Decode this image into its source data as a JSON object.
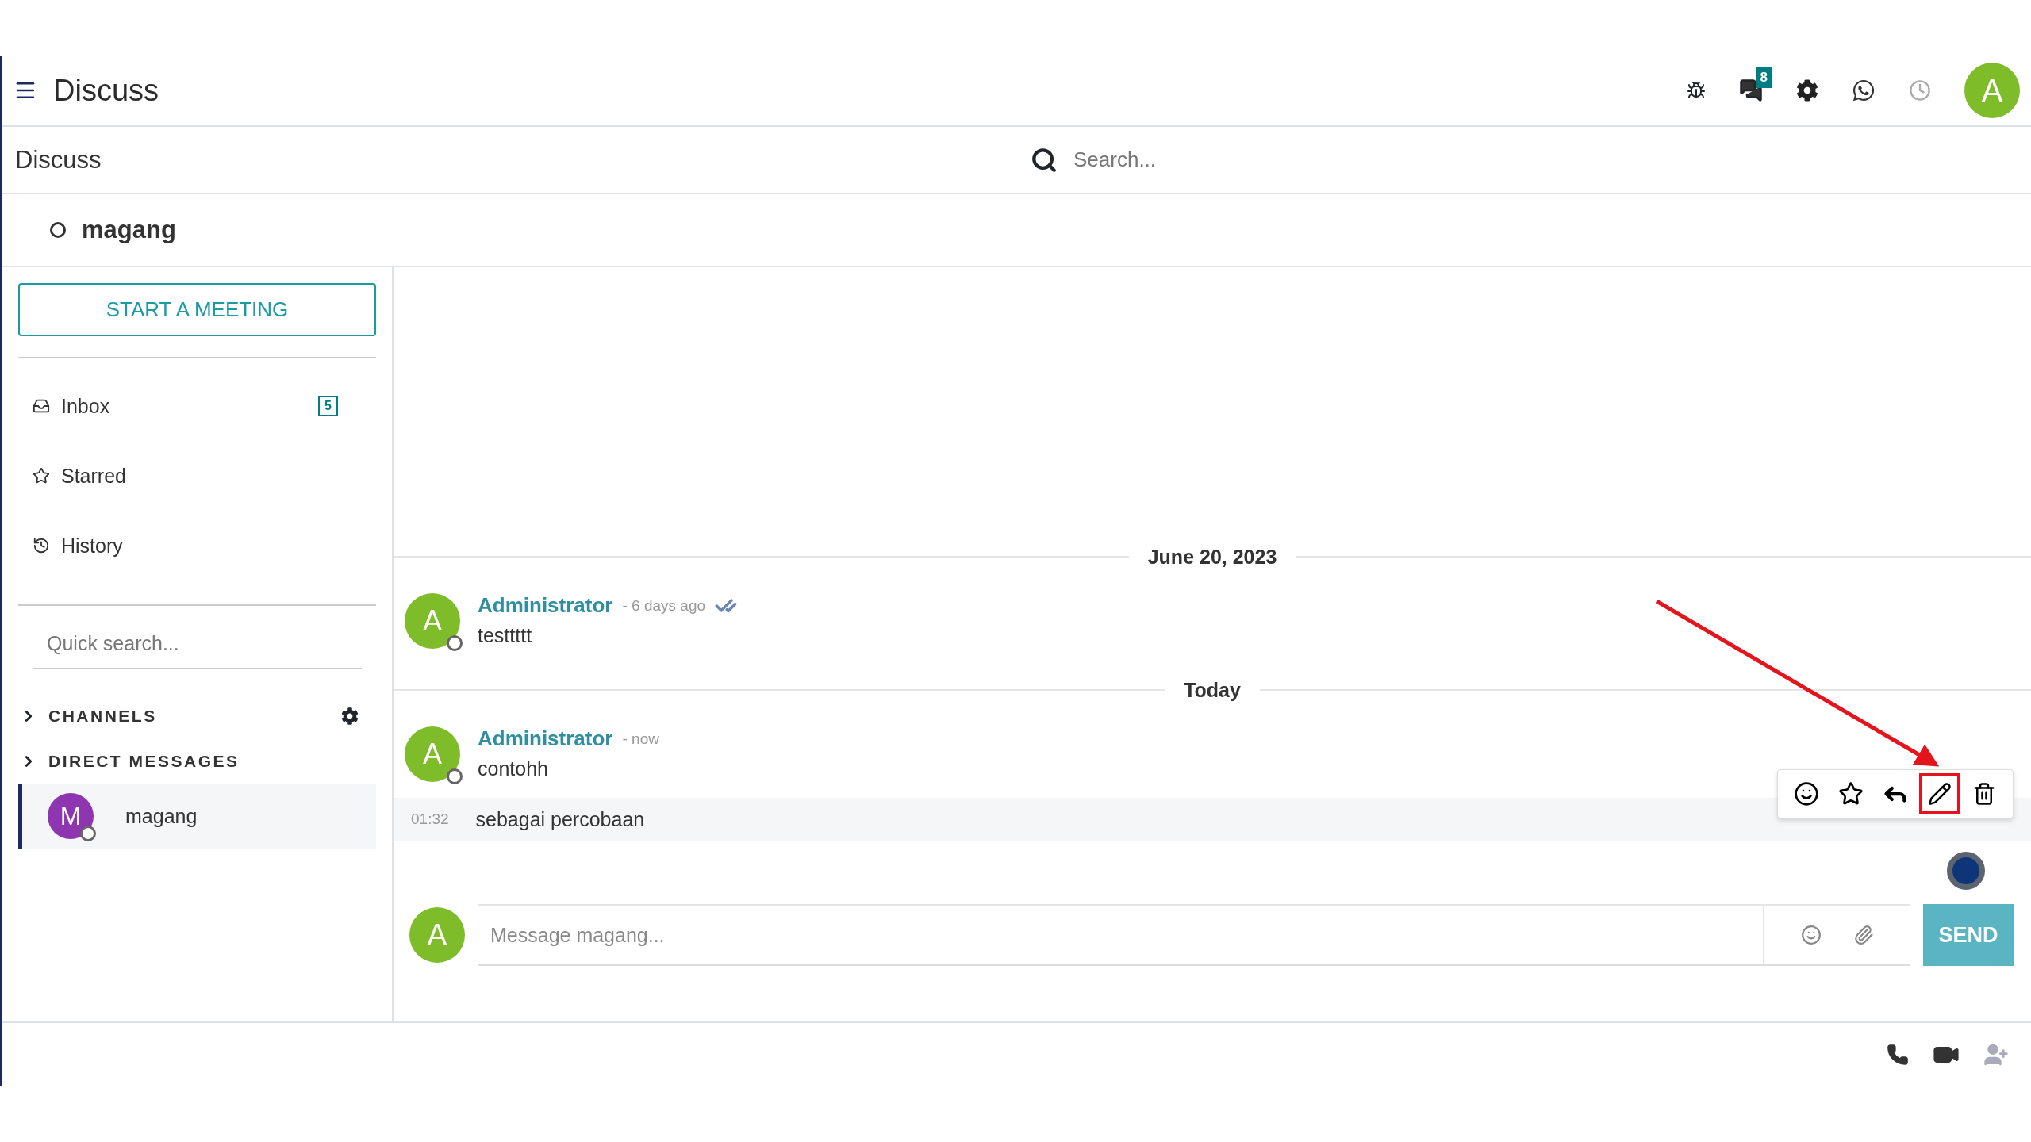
{
  "navbar": {
    "title": "Discuss",
    "chat_badge": "8",
    "avatar": "A"
  },
  "control_panel": {
    "breadcrumb": "Discuss",
    "search": {
      "placeholder": "Search..."
    }
  },
  "thread_header": {
    "name": "magang"
  },
  "sidebar": {
    "meeting_button": "START A MEETING",
    "mailboxes": [
      {
        "kind": "inbox",
        "label": "Inbox",
        "counter": "5"
      },
      {
        "kind": "starred",
        "label": "Starred"
      },
      {
        "kind": "history",
        "label": "History"
      }
    ],
    "quick_search": {
      "placeholder": "Quick search..."
    },
    "categories": [
      {
        "label": "CHANNELS",
        "settings": true
      },
      {
        "label": "DIRECT MESSAGES",
        "settings": false,
        "items": [
          {
            "name": "magang",
            "avatar": "M",
            "selected": true
          }
        ]
      }
    ]
  },
  "timeline": [
    {
      "kind": "separator",
      "label": "June 20, 2023"
    },
    {
      "kind": "message",
      "author": "Administrator",
      "avatar": "A",
      "date": "- 6 days ago",
      "seen": true,
      "body": "testtttt"
    },
    {
      "kind": "separator",
      "label": "Today"
    },
    {
      "kind": "message",
      "author": "Administrator",
      "avatar": "A",
      "date": "- now",
      "seen": false,
      "body": "contohh"
    },
    {
      "kind": "followup",
      "time": "01:32",
      "body": "sebagai percobaan",
      "hovered": true
    }
  ],
  "message_actions": [
    {
      "kind": "emoji",
      "highlighted": false
    },
    {
      "kind": "star",
      "highlighted": false
    },
    {
      "kind": "reply",
      "highlighted": false
    },
    {
      "kind": "edit",
      "highlighted": true
    },
    {
      "kind": "delete",
      "highlighted": false
    }
  ],
  "composer": {
    "avatar": "A",
    "placeholder": "Message magang...",
    "send": "SEND"
  }
}
